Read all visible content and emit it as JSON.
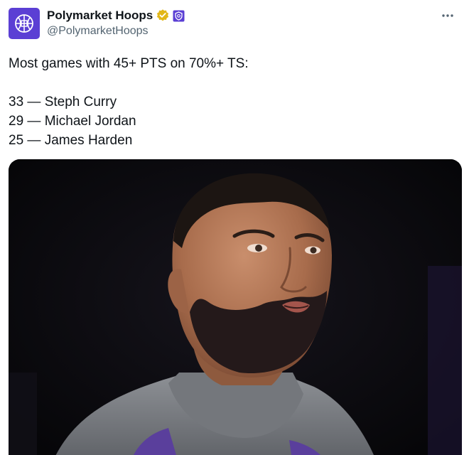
{
  "author": {
    "display_name": "Polymarket Hoops",
    "handle": "@PolymarketHoops",
    "avatar_icon": "basketball-logo-icon",
    "avatar_color": "#5b3fd4",
    "verified_badge_icon": "verified-badge-icon",
    "verified_color": "#e2b719",
    "affiliate_badge_icon": "affiliate-badge-icon"
  },
  "more_icon": "more-options-icon",
  "tweet": {
    "intro": "Most games with 45+ PTS on 70%+ TS:",
    "list": [
      {
        "count": "33",
        "separator": "—",
        "player": "Steph Curry"
      },
      {
        "count": "29",
        "separator": "—",
        "player": "Michael Jordan"
      },
      {
        "count": "25",
        "separator": "—",
        "player": "James Harden"
      }
    ]
  },
  "media": {
    "subject": "basketball-player-photo"
  }
}
